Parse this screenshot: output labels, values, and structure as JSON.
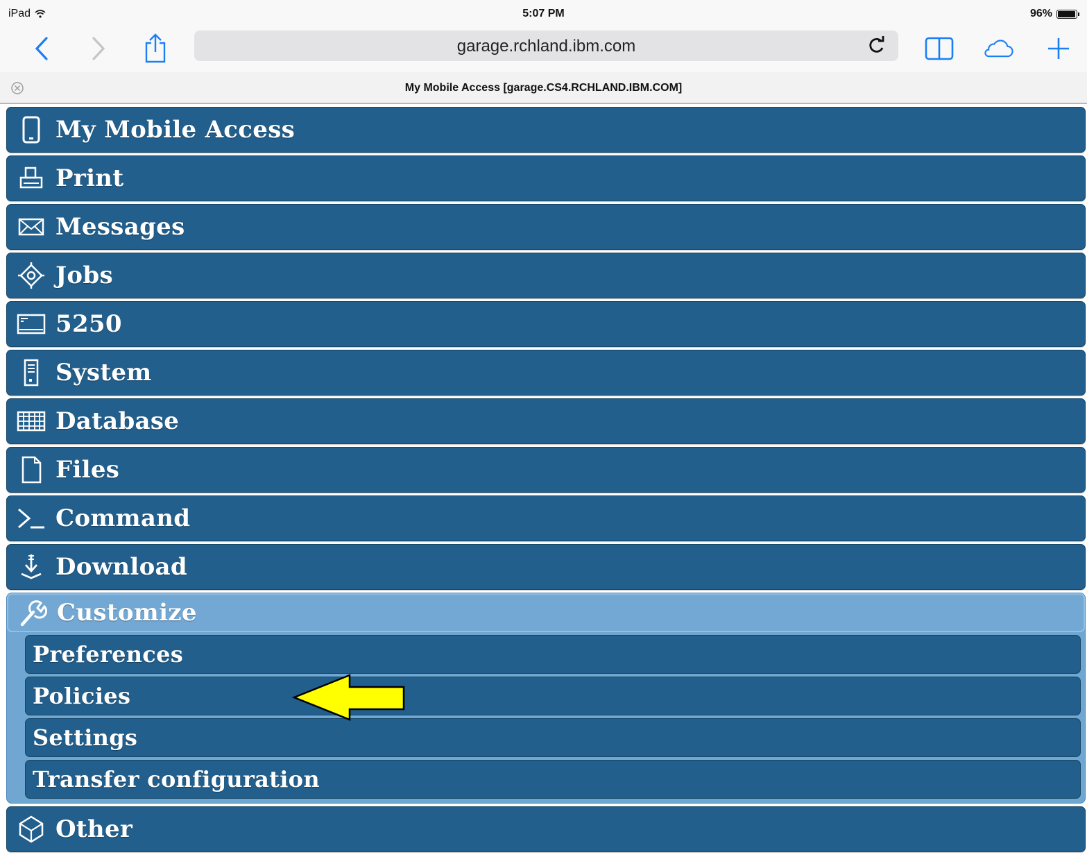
{
  "status_bar": {
    "device": "iPad",
    "time": "5:07 PM",
    "battery": "96%"
  },
  "browser": {
    "url": "garage.rchland.ibm.com",
    "tab_title": "My Mobile Access [garage.CS4.RCHLAND.IBM.COM]"
  },
  "menu": {
    "items": [
      {
        "label": "My Mobile Access",
        "icon": "mobile-device-icon"
      },
      {
        "label": "Print",
        "icon": "printer-icon"
      },
      {
        "label": "Messages",
        "icon": "envelope-icon"
      },
      {
        "label": "Jobs",
        "icon": "jobs-gear-icon"
      },
      {
        "label": "5250",
        "icon": "terminal-screen-icon"
      },
      {
        "label": "System",
        "icon": "server-tower-icon"
      },
      {
        "label": "Database",
        "icon": "table-grid-icon"
      },
      {
        "label": "Files",
        "icon": "document-icon"
      },
      {
        "label": "Command",
        "icon": "command-prompt-icon"
      },
      {
        "label": "Download",
        "icon": "download-icon"
      }
    ],
    "customize": {
      "label": "Customize",
      "icon": "wrench-icon",
      "subitems": [
        "Preferences",
        "Policies",
        "Settings",
        "Transfer configuration"
      ]
    },
    "other": {
      "label": "Other",
      "icon": "cube-icon"
    }
  },
  "colors": {
    "item_bg": "#225f8c",
    "expanded_bg": "#6fa7d2",
    "arrow": "#ffff00"
  }
}
